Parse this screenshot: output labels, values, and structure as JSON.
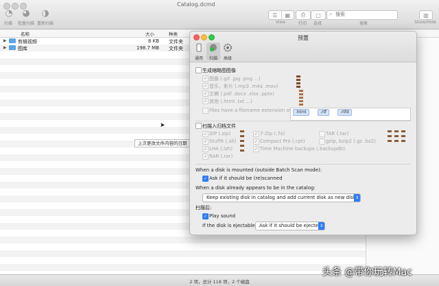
{
  "window": {
    "title": "Catalog.dcmd"
  },
  "toolbar": {
    "scan_label": "扫描",
    "batch_scan_label": "批量扫描",
    "rescan_label": "重新扫描",
    "view_label": "View",
    "print_label": "打印",
    "select_label": "选择",
    "search_label": "搜索",
    "show_hide_label": "Show/Hide",
    "search_placeholder": "搜索"
  },
  "columns": {
    "name": "名称",
    "size": "大小",
    "kind": "种类"
  },
  "files": [
    {
      "name": "剪辑视频",
      "size": "8 KB",
      "kind": "文件夹"
    },
    {
      "name": "图库",
      "size": "198.7 MB",
      "kind": "文件夹"
    }
  ],
  "tooltip": "上次更改文件内容的日期",
  "status": "2 项，总计 118 项，2 个磁盘",
  "watermark": "头条 @带你玩转Mac",
  "prefs": {
    "title": "预置",
    "tabs": [
      {
        "label": "通用",
        "icon": "general-icon"
      },
      {
        "label": "扫描",
        "icon": "scan-icon"
      },
      {
        "label": "高级",
        "icon": "gear-icon"
      }
    ],
    "thumbs_label": "生成缩略图图像",
    "thumb_options": [
      "图像 (.gif .jpg .png ...)",
      "音乐，影片 (.mp3 .m4a .mov)",
      "文稿 (.pdf .docx .xlsx .pptx)",
      "其他 (.html .txt ...)"
    ],
    "ext_label": "Files have a filename extension of:",
    "extensions": [
      ".html",
      ".rtf",
      ".rtfd"
    ],
    "archives_label": "扫描入归档文件",
    "archive_col1": [
      "ZIP (.zip)",
      "StuffIt (.sit)",
      "LHA (.lzh)",
      "RAR (.rar)"
    ],
    "archive_col2": [
      "7-Zip (.7z)",
      "Compact Pro (.cpt)",
      "Time Machine backups (.backupdb)"
    ],
    "archive_col3": [
      "TAR (.tar)",
      "gzip, bzip2 (.gz .bz2)"
    ],
    "mounted_label": "When a disk is mounted (outside Batch Scan mode):",
    "ask_rescan_label": "Ask if it should be (re)scanned",
    "already_label": "When a disk already appears to be in the catalog:",
    "already_value": "Keep existing disk in catalog and add current disk as new disk",
    "after_scan_label": "扫描后:",
    "play_sound_label": "Play sound",
    "ejectable_label": "If the disk is ejectable:",
    "ejectable_value": "Ask if it should be ejected"
  },
  "colors": {
    "accent": "#2e7df6",
    "folder": "#5aa4e8"
  }
}
